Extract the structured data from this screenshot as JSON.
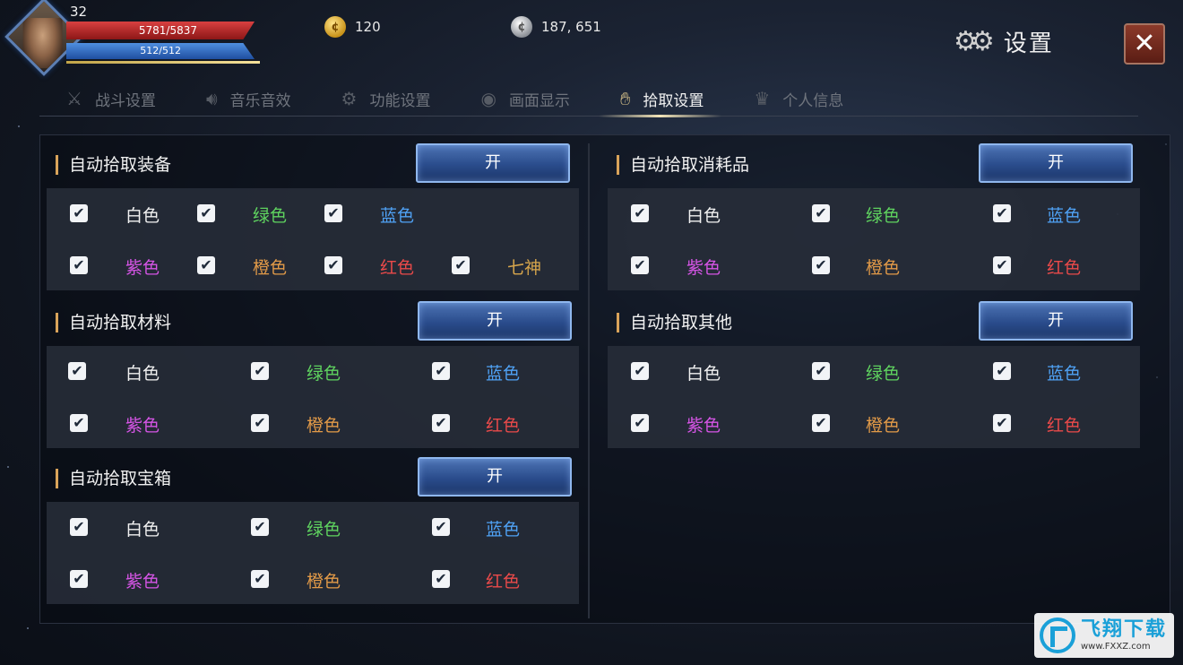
{
  "player": {
    "level": "32",
    "hp": "5781/5837",
    "mp": "512/512"
  },
  "currency": {
    "gold": "120",
    "silver": "187, 651"
  },
  "header": {
    "title": "设置"
  },
  "tabs": [
    {
      "label": "战斗设置",
      "icon": "crossed-swords-icon",
      "active": false
    },
    {
      "label": "音乐音效",
      "icon": "speaker-icon",
      "active": false
    },
    {
      "label": "功能设置",
      "icon": "gear-icon",
      "active": false
    },
    {
      "label": "画面显示",
      "icon": "eye-icon",
      "active": false
    },
    {
      "label": "拾取设置",
      "icon": "hand-icon",
      "active": true
    },
    {
      "label": "个人信息",
      "icon": "helmet-icon",
      "active": false
    }
  ],
  "sections": [
    {
      "title": "自动拾取装备",
      "toggle": "开",
      "rows": [
        [
          {
            "label": "白色",
            "checked": true
          },
          {
            "label": "绿色",
            "checked": true
          },
          {
            "label": "蓝色",
            "checked": true
          }
        ],
        [
          {
            "label": "紫色",
            "checked": true
          },
          {
            "label": "橙色",
            "checked": true
          },
          {
            "label": "红色",
            "checked": true
          },
          {
            "label": "七神",
            "checked": true
          }
        ]
      ]
    },
    {
      "title": "自动拾取材料",
      "toggle": "开",
      "rows": [
        [
          {
            "label": "白色",
            "checked": true
          },
          {
            "label": "绿色",
            "checked": true
          },
          {
            "label": "蓝色",
            "checked": true
          }
        ],
        [
          {
            "label": "紫色",
            "checked": true
          },
          {
            "label": "橙色",
            "checked": true
          },
          {
            "label": "红色",
            "checked": true
          }
        ]
      ]
    },
    {
      "title": "自动拾取宝箱",
      "toggle": "开",
      "rows": [
        [
          {
            "label": "白色",
            "checked": true
          },
          {
            "label": "绿色",
            "checked": true
          },
          {
            "label": "蓝色",
            "checked": true
          }
        ],
        [
          {
            "label": "紫色",
            "checked": true
          },
          {
            "label": "橙色",
            "checked": true
          },
          {
            "label": "红色",
            "checked": true
          }
        ]
      ]
    },
    {
      "title": "自动拾取消耗品",
      "toggle": "开",
      "rows": [
        [
          {
            "label": "白色",
            "checked": true
          },
          {
            "label": "绿色",
            "checked": true
          },
          {
            "label": "蓝色",
            "checked": true
          }
        ],
        [
          {
            "label": "紫色",
            "checked": true
          },
          {
            "label": "橙色",
            "checked": true
          },
          {
            "label": "红色",
            "checked": true
          }
        ]
      ]
    },
    {
      "title": "自动拾取其他",
      "toggle": "开",
      "rows": [
        [
          {
            "label": "白色",
            "checked": true
          },
          {
            "label": "绿色",
            "checked": true
          },
          {
            "label": "蓝色",
            "checked": true
          }
        ],
        [
          {
            "label": "紫色",
            "checked": true
          },
          {
            "label": "橙色",
            "checked": true
          },
          {
            "label": "红色",
            "checked": true
          }
        ]
      ]
    }
  ],
  "watermark": {
    "name": "飞翔下载",
    "url": "www.FXXZ.com"
  }
}
